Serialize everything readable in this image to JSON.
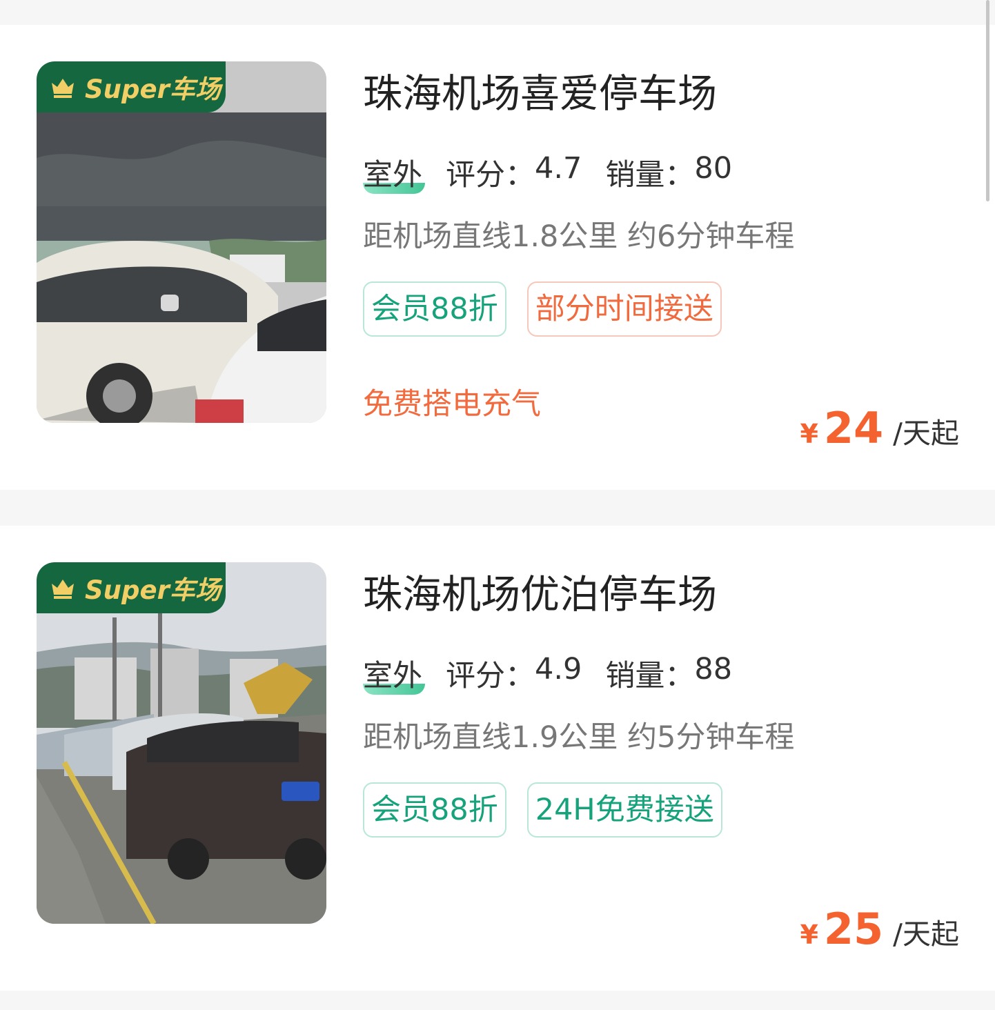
{
  "listings": [
    {
      "badge": "Super车场",
      "title": "珠海机场喜爱停车场",
      "type": "室外",
      "rating_label": "评分：",
      "rating": "4.7",
      "sales_label": "销量：",
      "sales": "80",
      "distance": "距机场直线1.8公里 约6分钟车程",
      "tags": [
        "会员88折",
        "部分时间接送"
      ],
      "service": "免费搭电充气",
      "price_currency": "¥",
      "price_amount": "24",
      "price_unit": "/天起"
    },
    {
      "badge": "Super车场",
      "title": "珠海机场优泊停车场",
      "type": "室外",
      "rating_label": "评分：",
      "rating": "4.9",
      "sales_label": "销量：",
      "sales": "88",
      "distance": "距机场直线1.9公里 约5分钟车程",
      "tags": [
        "会员88折",
        "24H免费接送"
      ],
      "service": "",
      "price_currency": "¥",
      "price_amount": "25",
      "price_unit": "/天起"
    }
  ],
  "colors": {
    "accent_green": "#15673f",
    "badge_gold": "#f1ce66",
    "price_orange": "#f4632f",
    "tag_green": "#16a27b",
    "tag_orange": "#f06a3e"
  },
  "icons": {
    "badge": "crown-icon"
  }
}
